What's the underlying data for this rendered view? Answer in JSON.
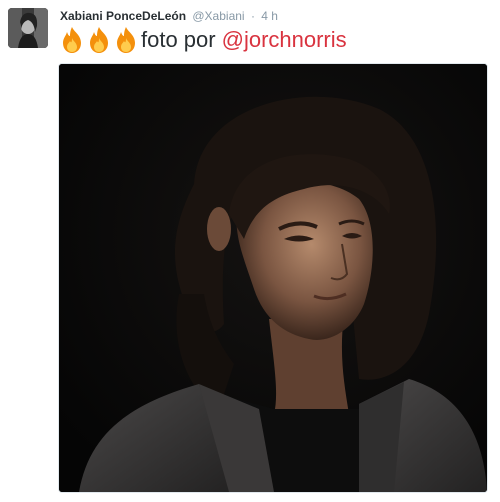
{
  "tweet": {
    "display_name": "Xabiani PonceDeLeón",
    "handle": "@Xabiani",
    "separator": "·",
    "time": "4 h",
    "text": "foto por",
    "mention": "@jorchnorris",
    "emojis": [
      "fire-icon",
      "fire-icon",
      "fire-icon"
    ]
  },
  "colors": {
    "name": "#292f33",
    "meta": "#8899a6",
    "mention": "#d9333f",
    "fire_outer": "#f4900c",
    "fire_inner": "#ffcc4d"
  }
}
